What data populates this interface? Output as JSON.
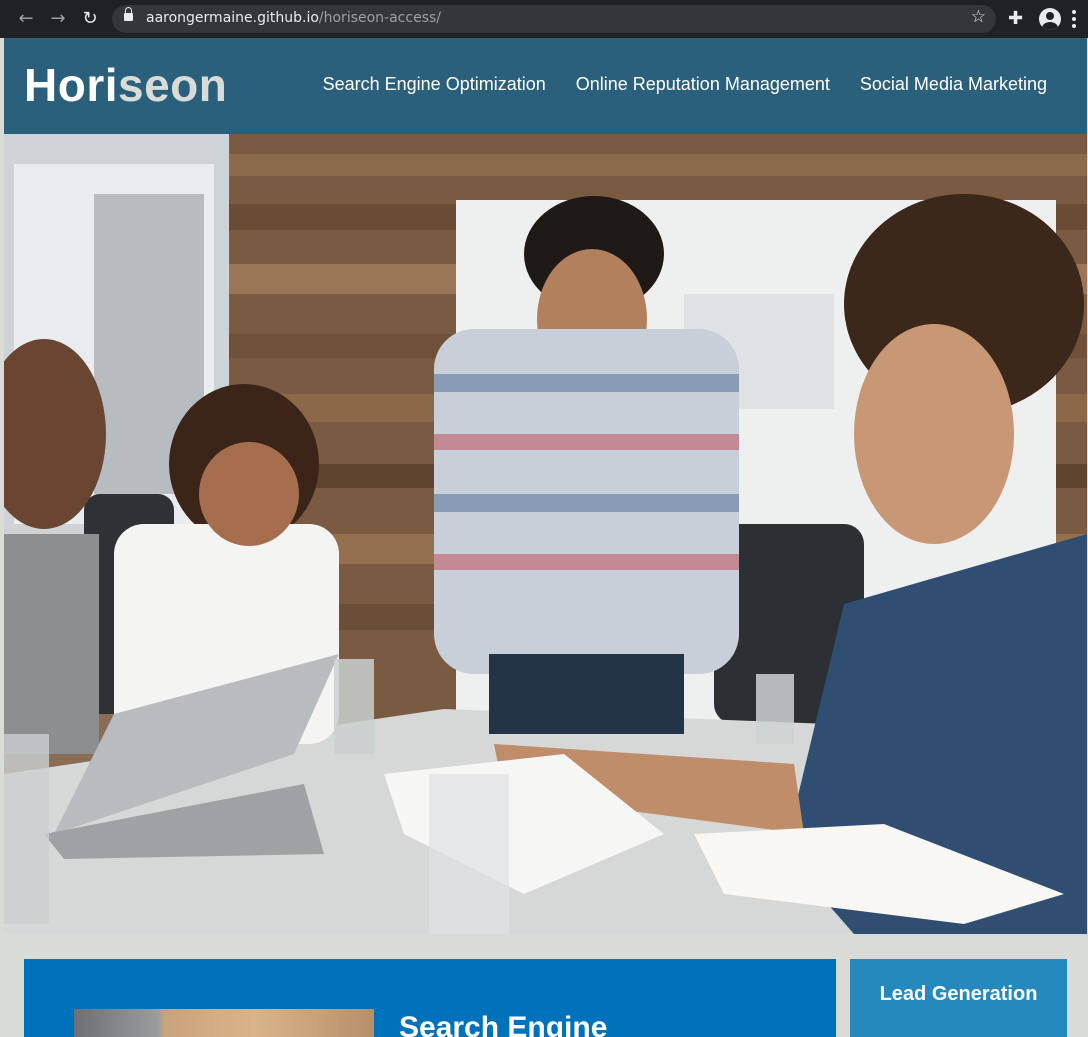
{
  "browser": {
    "url_host": "aarongermaine.github.io",
    "url_path": "/horiseon-access/",
    "icons": [
      "back-icon",
      "forward-icon",
      "reload-icon",
      "lock-icon",
      "star-icon",
      "extensions-icon",
      "profile-icon",
      "menu-icon"
    ]
  },
  "header": {
    "logo_main": "Hori",
    "logo_accent": "seon",
    "nav": [
      "Search Engine Optimization",
      "Online Reputation Management",
      "Social Media Marketing"
    ]
  },
  "main": {
    "card_heading": "Search Engine",
    "side_heading": "Lead Generation"
  },
  "colors": {
    "header_bg": "#2a607c",
    "page_bg": "#d9dcd6",
    "card_bg": "#0072bb",
    "side_card_bg": "#2589bd"
  }
}
